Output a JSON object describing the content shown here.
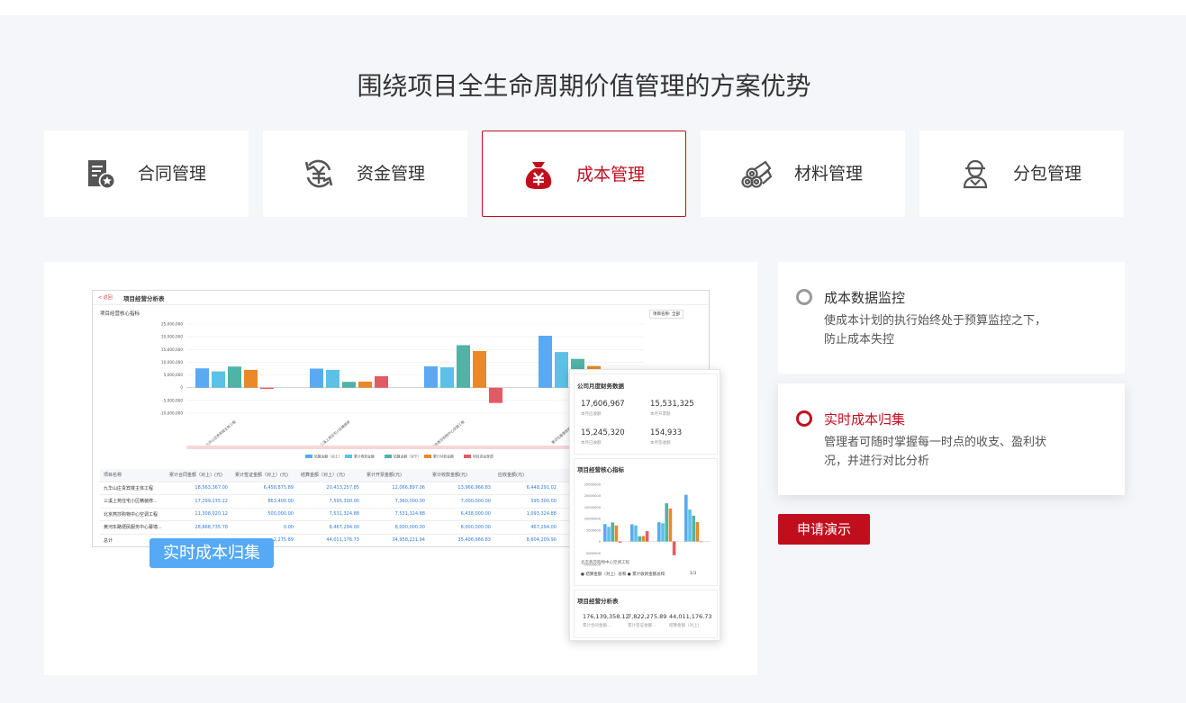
{
  "title": "围绕项目全生命周期价值管理的方案优势",
  "tabs": [
    {
      "label": "合同管理",
      "icon": "contract-icon"
    },
    {
      "label": "资金管理",
      "icon": "money-exchange-icon"
    },
    {
      "label": "成本管理",
      "icon": "money-bag-icon",
      "active": true
    },
    {
      "label": "材料管理",
      "icon": "materials-icon"
    },
    {
      "label": "分包管理",
      "icon": "worker-icon"
    }
  ],
  "colors": {
    "accent": "#c10e1d",
    "badge": "#56a9f5"
  },
  "dashboard": {
    "back": "< 返回",
    "title": "项目经营分析表",
    "subtitle": "项目经营核心指标",
    "project_filter": "项目名称: 全部",
    "yticks": [
      "25,000,000",
      "20,000,000",
      "15,000,000",
      "10,000,000",
      "5,000,000",
      "0",
      "-5,000,000",
      "-10,000,000"
    ],
    "legend": [
      "结算金额（对上）",
      "累计收款金额",
      "结算金额（对下）",
      "累计付款金额",
      "项目资金穿透"
    ],
    "table_headers": [
      "项目名称",
      "累计合同金额（对上）(元)",
      "累计签证金额（对上）(元)",
      "结算金额（对上）(元)",
      "累计开票金额(元)",
      "累计收款金额(元)",
      "应收金额(元)"
    ],
    "table_rows": [
      [
        "九华山庄贵宾楼主体工程",
        "18,563,367.00",
        "6,458,875.89",
        "20,413,257.85",
        "12,066,897.06",
        "13,966,966.83",
        "6,448,291.02"
      ],
      [
        "三溪上苑住宅小区精装修...",
        "17,299,235.22",
        "863,400.00",
        "7,595,300.00",
        "7,360,000.00",
        "7,000,000.00",
        "595,300.00"
      ],
      [
        "北京燕莎购物中心空调工程",
        "11,308,020.12",
        "500,000.00",
        "7,531,324.88",
        "7,531,324.88",
        "6,438,000.00",
        "1,093,324.88"
      ],
      [
        "黄河东路便民服务中心幕墙...",
        "28,868,735.78",
        "0.00",
        "8,467,294.00",
        "8,000,000.00",
        "8,000,000.00",
        "467,294.00"
      ],
      [
        "总计",
        "",
        "2,275.89",
        "44,011,176.73",
        "34,958,221.94",
        "35,406,966.83",
        "8,604,209.90"
      ]
    ]
  },
  "chart_data": {
    "type": "bar",
    "categories": [
      "九华山庄贵宾楼主体工程",
      "三溪上苑住宅小区精装修",
      "北京燕莎购物中心空调工程",
      "黄河东路便民服务中心"
    ],
    "ylim": [
      -10000000,
      25000000
    ],
    "series": [
      {
        "name": "结算金额（对上）",
        "values": [
          7600000,
          7500000,
          8400000,
          20400000
        ]
      },
      {
        "name": "累计收款金额",
        "values": [
          6400000,
          7000000,
          8000000,
          14000000
        ]
      },
      {
        "name": "结算金额（对下）",
        "values": [
          8300000,
          2300000,
          16700000,
          11300000
        ]
      },
      {
        "name": "累计付款金额",
        "values": [
          7000000,
          2400000,
          14400000,
          8500000
        ]
      },
      {
        "name": "项目资金穿透",
        "values": [
          -500000,
          4500000,
          -6000000,
          0
        ]
      }
    ],
    "colors": [
      "#5aa9f2",
      "#5cc1e6",
      "#4fb3a6",
      "#e8892a",
      "#e05c64"
    ]
  },
  "panel": {
    "finance_title": "公司月度财务数据",
    "finance": [
      {
        "value": "17,606,967",
        "label": "本月应收额"
      },
      {
        "value": "15,531,325",
        "label": "本月开票额"
      },
      {
        "value": "15,245,320",
        "label": "本月已收额"
      },
      {
        "value": "154,933",
        "label": "本月签收额"
      }
    ],
    "core_title": "项目经营核心指标",
    "core_ticks": [
      "25000000",
      "20000000",
      "15000000",
      "10000000",
      "5000000",
      "0",
      "-5000000",
      "-10000000"
    ],
    "core_project": "北京燕莎购物中心空调工程",
    "core_legend": "● 结算金额（对上）总和  ● 累计收款金额总和",
    "core_page": "1/3",
    "analysis_title": "项目经营分析表",
    "analysis": [
      {
        "value": "176,139,358.12",
        "label": "累计合同金额..."
      },
      {
        "value": "7,822,275.89",
        "label": "累计签证金额..."
      },
      {
        "value": "44,011,176.73",
        "label": "结算金额（对上）"
      }
    ]
  },
  "badge": "实时成本归集",
  "features": [
    {
      "title": "成本数据监控",
      "desc": "使成本计划的执行始终处于预算监控之下，防止成本失控"
    },
    {
      "title": "实时成本归集",
      "desc": "管理者可随时掌握每一时点的收支、盈利状况，并进行对比分析",
      "active": true
    }
  ],
  "demo_button": "申请演示"
}
